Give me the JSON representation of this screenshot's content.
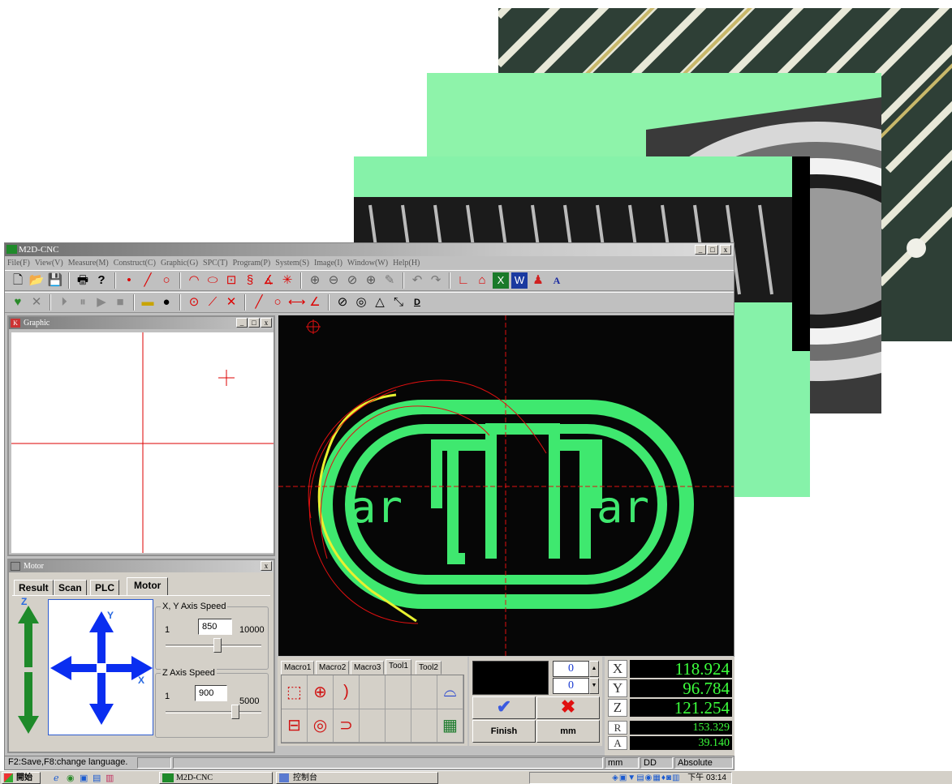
{
  "window": {
    "title": "M2D-CNC",
    "controls": [
      "_",
      "□",
      "x"
    ]
  },
  "menu": [
    "File(F)",
    "View(V)",
    "Measure(M)",
    "Construct(C)",
    "Graphic(G)",
    "SPC(T)",
    "Program(P)",
    "System(S)",
    "Image(I)",
    "Window(W)",
    "Help(H)"
  ],
  "toolbar": {
    "text_button": "A",
    "dim_button": "D"
  },
  "graphic_panel": {
    "title": "Graphic"
  },
  "motor_panel": {
    "title": "Motor",
    "tabs": [
      "Result",
      "Scan",
      "PLC",
      "Motor"
    ],
    "active_tab": "Motor",
    "jog": {
      "z_label": "Z",
      "y_label": "Y",
      "x_label": "X"
    },
    "xy_speed": {
      "label": "X, Y Axis Speed",
      "min": "1",
      "value": "850",
      "max": "10000",
      "fraction": 0.085
    },
    "z_speed": {
      "label": "Z Axis Speed",
      "min": "1",
      "value": "900",
      "max": "5000",
      "fraction": 0.18
    }
  },
  "camera": {
    "logo_text_left": "ar",
    "logo_text_right": "ar",
    "accent": "#39e36b"
  },
  "macro_panel": {
    "tabs": [
      "Macro1",
      "Macro2",
      "Macro3",
      "Tool1",
      "Tool2"
    ],
    "active_tab": "Tool1"
  },
  "counter_panel": {
    "top_value": "0",
    "bottom_value": "0",
    "finish_label": "Finish",
    "unit_label": "mm"
  },
  "dro": {
    "x_label": "X",
    "x_value": "118.924",
    "y_label": "Y",
    "y_value": "96.784",
    "z_label": "Z",
    "z_value": "121.254",
    "r_label": "R",
    "r_value": "153.329",
    "a_label": "A",
    "a_value": "39.140"
  },
  "status_bar": {
    "hint": "F2:Save,F8:change language.",
    "unit": "mm",
    "angle_mode": "DD",
    "coord_mode": "Absolute"
  },
  "taskbar": {
    "start": "開始",
    "task1": "M2D-CNC",
    "task2": "控制台",
    "clock": "下午 03:14"
  }
}
